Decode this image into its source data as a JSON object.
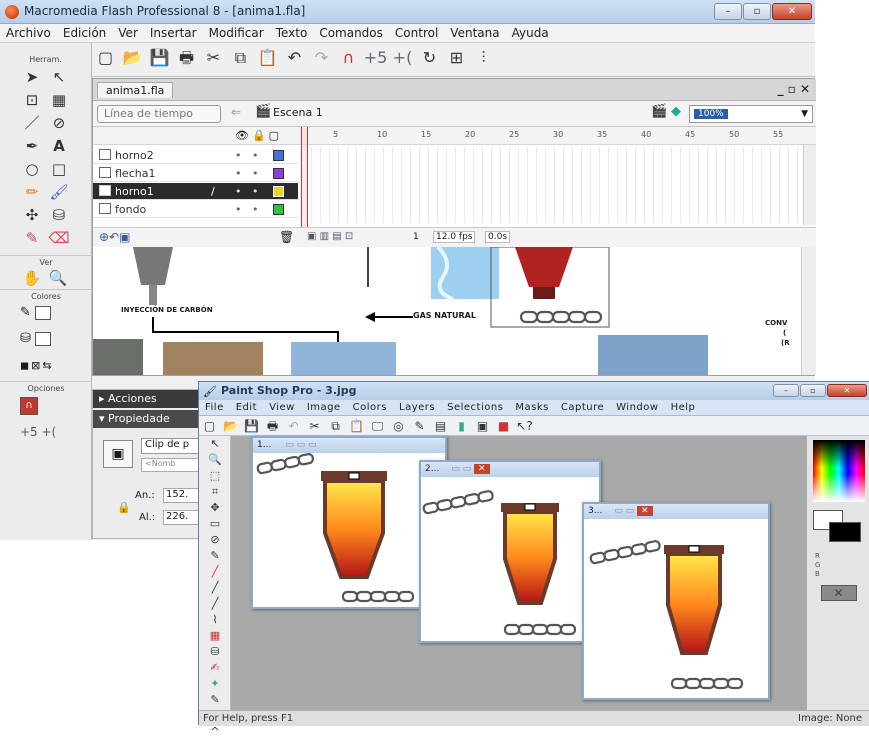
{
  "flash": {
    "title": "Macromedia Flash Professional 8 - [anima1.fla]",
    "menu": [
      "Archivo",
      "Edición",
      "Ver",
      "Insertar",
      "Modificar",
      "Texto",
      "Comandos",
      "Control",
      "Ventana",
      "Ayuda"
    ],
    "tools_header": "Herram.",
    "section_ver": "Ver",
    "section_colores": "Colores",
    "section_opciones": "Opciones",
    "doc_tab": "anima1.fla",
    "timeline_button": "Línea de tiempo",
    "scene_label": "Escena 1",
    "zoom_value": "100%",
    "frame_numbers": [
      "5",
      "10",
      "15",
      "20",
      "25",
      "30",
      "35",
      "40",
      "45",
      "50",
      "55"
    ],
    "layers": [
      {
        "name": "horno2",
        "color": "#4a6fd9"
      },
      {
        "name": "flecha1",
        "color": "#8a3fd0"
      },
      {
        "name": "horno1",
        "color": "#e8d81a",
        "selected": true
      },
      {
        "name": "fondo",
        "color": "#34c043"
      }
    ],
    "status": {
      "frame": "1",
      "fps": "12.0 fps",
      "time": "0.0s"
    },
    "stage_labels": {
      "injection": "INYECCIÓN DE CARBÓN",
      "gas": "GAS NATURAL",
      "conv_1": "CONV",
      "conv_2": "(",
      "conv_3": "(R"
    },
    "panel_acciones": "Acciones",
    "panel_propiedades": "Propiedade",
    "prop_clip": "Clip de p",
    "prop_name_placeholder": "<Nomb",
    "prop_an_label": "An.:",
    "prop_an_value": "152.",
    "prop_al_label": "Al.:",
    "prop_al_value": "226."
  },
  "psp": {
    "title": "Paint Shop Pro - 3.jpg",
    "menu": [
      "File",
      "Edit",
      "View",
      "Image",
      "Colors",
      "Layers",
      "Selections",
      "Masks",
      "Capture",
      "Window",
      "Help"
    ],
    "windows": [
      {
        "title": "1..."
      },
      {
        "title": "2..."
      },
      {
        "title": "3..."
      }
    ],
    "status_left": "For Help, press F1",
    "status_right": "Image: None"
  },
  "colors": {
    "accent": "#2b5ea8",
    "selected_layer": "#2b2b2b",
    "close": "#c8412b"
  }
}
